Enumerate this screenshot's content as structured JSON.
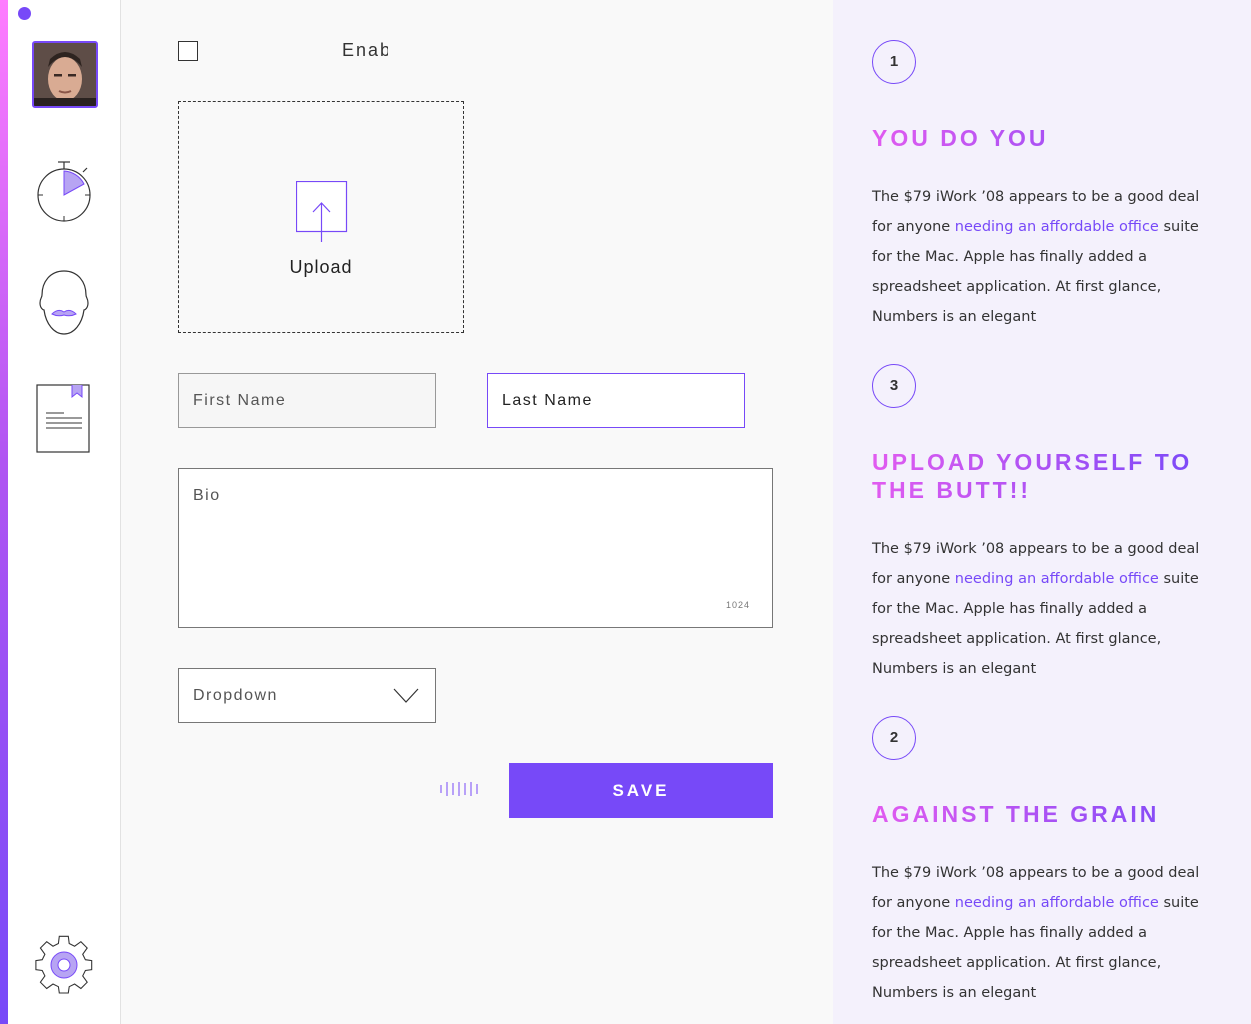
{
  "form": {
    "checkbox_label": "Enab",
    "upload_label": "Upload",
    "first_name_placeholder": "First Name",
    "last_name_value": "Last Name",
    "bio_placeholder": "Bio",
    "bio_char_count": "1024",
    "dropdown_label": "Dropdown",
    "save_label": "SAVE"
  },
  "steps": [
    {
      "number": "1",
      "title": "YOU DO YOU",
      "body_before": "The $79 iWork ’08 appears to be a good deal for anyone ",
      "body_link": "needing an affordable office",
      "body_after": " suite for the Mac. Apple has finally added a spreadsheet application. At first glance, Numbers is an elegant"
    },
    {
      "number": "3",
      "title": "UPLOAD YOURSELF TO THE BUTT!!",
      "body_before": "The $79 iWork ’08 appears to be a good deal for anyone ",
      "body_link": "needing an affordable office",
      "body_after": " suite for the Mac. Apple has finally added a spreadsheet application. At first glance, Numbers is an elegant"
    },
    {
      "number": "2",
      "title": "AGAINST THE GRAIN",
      "body_before": "The $79 iWork ’08 appears to be a good deal for anyone ",
      "body_link": "needing an affordable office",
      "body_after": " suite for the Mac. Apple has finally added a spreadsheet application. At first glance, Numbers is an elegant"
    }
  ],
  "icons": {
    "sidebar": [
      "avatar",
      "stopwatch-icon",
      "face-mustache-icon",
      "document-bookmark-icon",
      "gear-icon"
    ],
    "form": [
      "upload-arrow-icon",
      "chevron-down-icon",
      "loading-bars-icon"
    ]
  },
  "colors": {
    "accent": "#7749f8",
    "gradient_start": "#ff7dff",
    "panel_background": "#f4f1fc"
  }
}
